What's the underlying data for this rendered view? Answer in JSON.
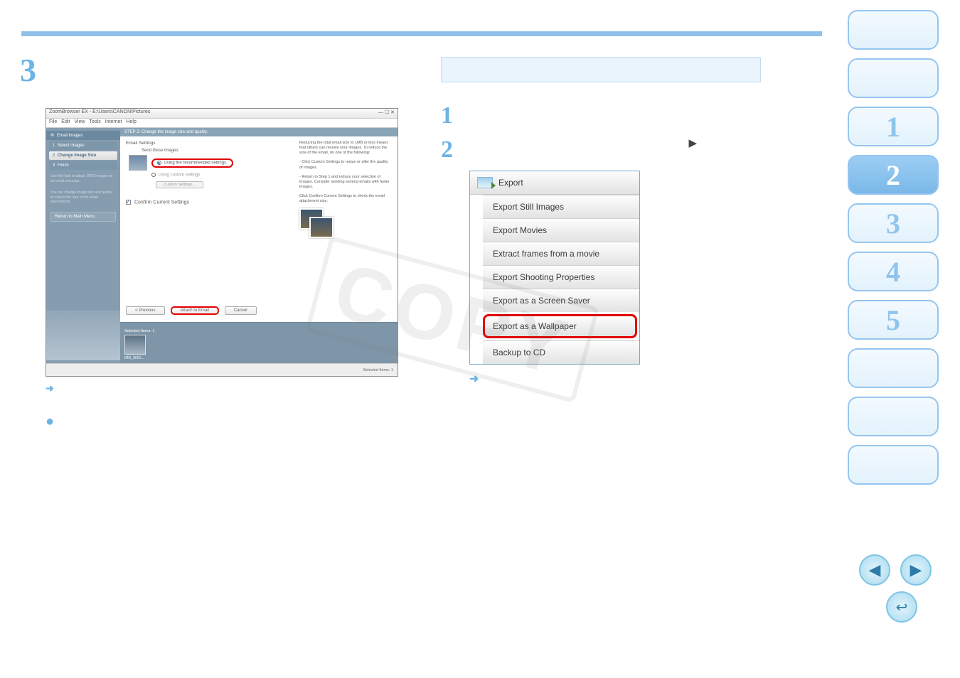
{
  "step_number": "3",
  "screenshot": {
    "title": "ZoomBrowser EX - E:\\Users\\CANON\\Pictures",
    "menus": [
      "File",
      "Edit",
      "View",
      "Tools",
      "Internet",
      "Help"
    ],
    "sidebar_header": "Email Images",
    "steps": [
      {
        "num": "1",
        "label": "Select Images"
      },
      {
        "num": "2",
        "label": "Change Image Size"
      },
      {
        "num": "3",
        "label": "Finish"
      }
    ],
    "note1": "Use this task to attach JPEG images to an email message.",
    "note2": "You can change image size and quality to reduce the size of the email attachments.",
    "return": "Return to Main Menu",
    "step_title": "STEP 2: Change the image size and quality.",
    "section_email_settings": "Email Settings",
    "send_label": "Send these images:",
    "radio_recommended": "Using the recommended settings.",
    "radio_custom": "Using custom settings.",
    "custom_btn": "Custom Settings...",
    "confirm_label": "Confirm Current Settings",
    "tip_header": "Reducing the total email size to 1MB or less means that others can receive your images. To reduce the size of the email, do one of the following:",
    "tip1": "- Click Custom Settings to resize or alter the quality of images.",
    "tip2": "- Return to Step 1 and reduce your selection of images. Consider sending several emails with fewer images.",
    "tip3": "Click Confirm Current Settings to check the email attachment size.",
    "btn_prev": "< Previous",
    "btn_attach": "Attach to Email",
    "btn_cancel": "Cancel",
    "selected_label": "Selected Items: 1",
    "thumb_name": "IMG_0001...",
    "status": "Selected Items: 1"
  },
  "right": {
    "step1_num": "1",
    "step2_num": "2",
    "triangle": "▶"
  },
  "export_menu": {
    "header": "Export",
    "items": [
      "Export Still Images",
      "Export Movies",
      "Extract frames from a movie",
      "Export Shooting Properties",
      "Export as a Screen Saver",
      "Export as a Wallpaper",
      "Backup to CD"
    ],
    "highlight_index": 5
  },
  "nav": {
    "chapters": [
      "1",
      "2",
      "3",
      "4",
      "5"
    ]
  },
  "arrow_glyph": "➜",
  "watermark": "COPY",
  "nav_prev": "◀",
  "nav_next": "▶",
  "nav_return": "↩"
}
